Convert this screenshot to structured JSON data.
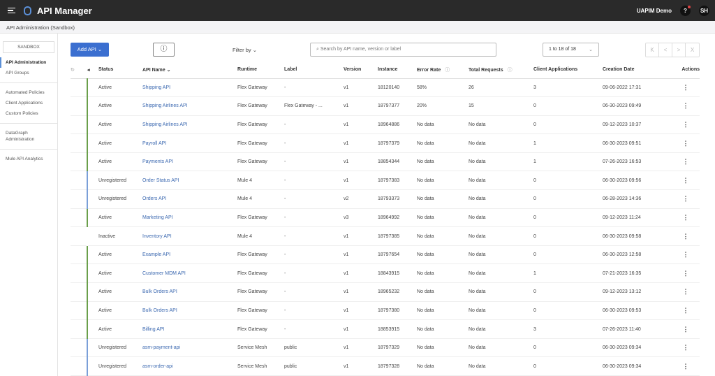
{
  "app": {
    "title": "API Manager",
    "org": "UAPIM Demo",
    "help": "?",
    "avatar": "SH"
  },
  "breadcrumb": "API Administration (Sandbox)",
  "sidebar": {
    "env": "SANDBOX",
    "items": [
      "API Administration",
      "API Groups",
      "Automated Policies",
      "Client Applications",
      "Custom Policies",
      "DataGraph Administration",
      "Mule API Analytics"
    ]
  },
  "toolbar": {
    "add": "Add API ⌄",
    "info": "ⓘ",
    "filter": "Filter by ⌄",
    "search_placeholder": "Search by API name, version or label",
    "pager": "1 to 18 of 18",
    "nav": [
      "K",
      "<",
      ">",
      "X"
    ]
  },
  "columns": [
    "Status",
    "API Name ⌄",
    "Runtime",
    "Label",
    "Version",
    "Instance",
    "Error Rate",
    "Total Requests",
    "Client Applications",
    "Creation Date",
    "Actions"
  ],
  "rows": [
    [
      "Active",
      "Shipping API",
      "Flex Gateway",
      "-",
      "v1",
      "18120140",
      "58%",
      "26",
      "3",
      "09-06-2022 17:31"
    ],
    [
      "Active",
      "Shipping Airlines API",
      "Flex Gateway",
      "Flex Gateway - ...",
      "v1",
      "18797377",
      "20%",
      "15",
      "0",
      "06-30-2023 09:49"
    ],
    [
      "Active",
      "Shipping Airlines API",
      "Flex Gateway",
      "-",
      "v1",
      "18964886",
      "No data",
      "No data",
      "0",
      "09-12-2023 10:37"
    ],
    [
      "Active",
      "Payroll API",
      "Flex Gateway",
      "-",
      "v1",
      "18797379",
      "No data",
      "No data",
      "1",
      "06-30-2023 09:51"
    ],
    [
      "Active",
      "Payments API",
      "Flex Gateway",
      "-",
      "v1",
      "18854344",
      "No data",
      "No data",
      "1",
      "07-26-2023 16:53"
    ],
    [
      "Unregistered",
      "Order Status API",
      "Mule 4",
      "-",
      "v1",
      "18797383",
      "No data",
      "No data",
      "0",
      "06-30-2023 09:56"
    ],
    [
      "Unregistered",
      "Orders API",
      "Mule 4",
      "-",
      "v2",
      "18793373",
      "No data",
      "No data",
      "0",
      "06-28-2023 14:36"
    ],
    [
      "Active",
      "Marketing API",
      "Flex Gateway",
      "-",
      "v3",
      "18964992",
      "No data",
      "No data",
      "0",
      "09-12-2023 11:24"
    ],
    [
      "Inactive",
      "Inventory API",
      "Mule 4",
      "-",
      "v1",
      "18797385",
      "No data",
      "No data",
      "0",
      "06-30-2023 09:58"
    ],
    [
      "Active",
      "Example API",
      "Flex Gateway",
      "-",
      "v1",
      "18797654",
      "No data",
      "No data",
      "0",
      "06-30-2023 12:58"
    ],
    [
      "Active",
      "Customer MDM API",
      "Flex Gateway",
      "-",
      "v1",
      "18843915",
      "No data",
      "No data",
      "1",
      "07-21-2023 16:35"
    ],
    [
      "Active",
      "Bulk Orders API",
      "Flex Gateway",
      "-",
      "v1",
      "18965232",
      "No data",
      "No data",
      "0",
      "09-12-2023 13:12"
    ],
    [
      "Active",
      "Bulk Orders API",
      "Flex Gateway",
      "-",
      "v1",
      "18797380",
      "No data",
      "No data",
      "0",
      "06-30-2023 09:53"
    ],
    [
      "Active",
      "Billing API",
      "Flex Gateway",
      "-",
      "v1",
      "18853915",
      "No data",
      "No data",
      "3",
      "07-26-2023 11:40"
    ],
    [
      "Unregistered",
      "asm-payment-api",
      "Service Mesh",
      "public",
      "v1",
      "18797329",
      "No data",
      "No data",
      "0",
      "06-30-2023 09:34"
    ],
    [
      "Unregistered",
      "asm-order-api",
      "Service Mesh",
      "public",
      "v1",
      "18797328",
      "No data",
      "No data",
      "0",
      "06-30-2023 09:34"
    ]
  ]
}
